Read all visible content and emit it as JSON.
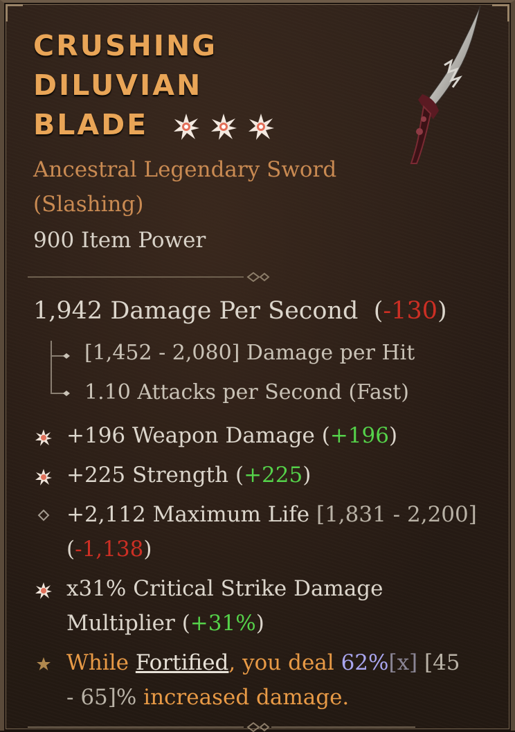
{
  "item": {
    "name_lines": [
      "CRUSHING",
      "DILUVIAN",
      "BLADE"
    ],
    "type_line_1": "Ancestral Legendary Sword",
    "type_line_2": "(Slashing)",
    "item_power": "900 Item Power",
    "colors": {
      "title": "#e9a557",
      "legendary": "#e89a46",
      "negative": "#cc2f24",
      "positive": "#55d24a",
      "roll": "#a9a6f0"
    }
  },
  "dps": {
    "label": "1,942 Damage Per Second",
    "delta_open": "(",
    "delta": "-130",
    "delta_close": ")"
  },
  "base_stats": [
    "[1,452 - 2,080] Damage per Hit",
    "1.10 Attacks per Second (Fast)"
  ],
  "affixes": {
    "weapon_damage": {
      "text": "+196 Weapon Damage ",
      "open": "(",
      "delta": "+196",
      "close": ")",
      "icon": "greater-affix-icon"
    },
    "strength": {
      "text": "+225 Strength ",
      "open": "(",
      "delta": "+225",
      "close": ")",
      "icon": "greater-affix-icon"
    },
    "max_life": {
      "text": "+2,112 Maximum Life ",
      "range": "[1,831 - 2,200]",
      "open": "(",
      "delta": "-1,138",
      "close": ")",
      "icon": "regular-affix-icon"
    },
    "crit": {
      "line1": "x31% Critical Strike Damage",
      "line2_text": "Multiplier ",
      "open": "(",
      "delta": "+31%",
      "close": ")",
      "icon": "greater-affix-icon"
    }
  },
  "legendary_power": {
    "pre": "While ",
    "keyword": "Fortified",
    "mid": ", you deal ",
    "value": "62%",
    "x_tag": "[x]",
    "range": " [45",
    "range2": "- 65]%",
    "post": " increased damage.",
    "icon": "legendary-star-icon"
  }
}
